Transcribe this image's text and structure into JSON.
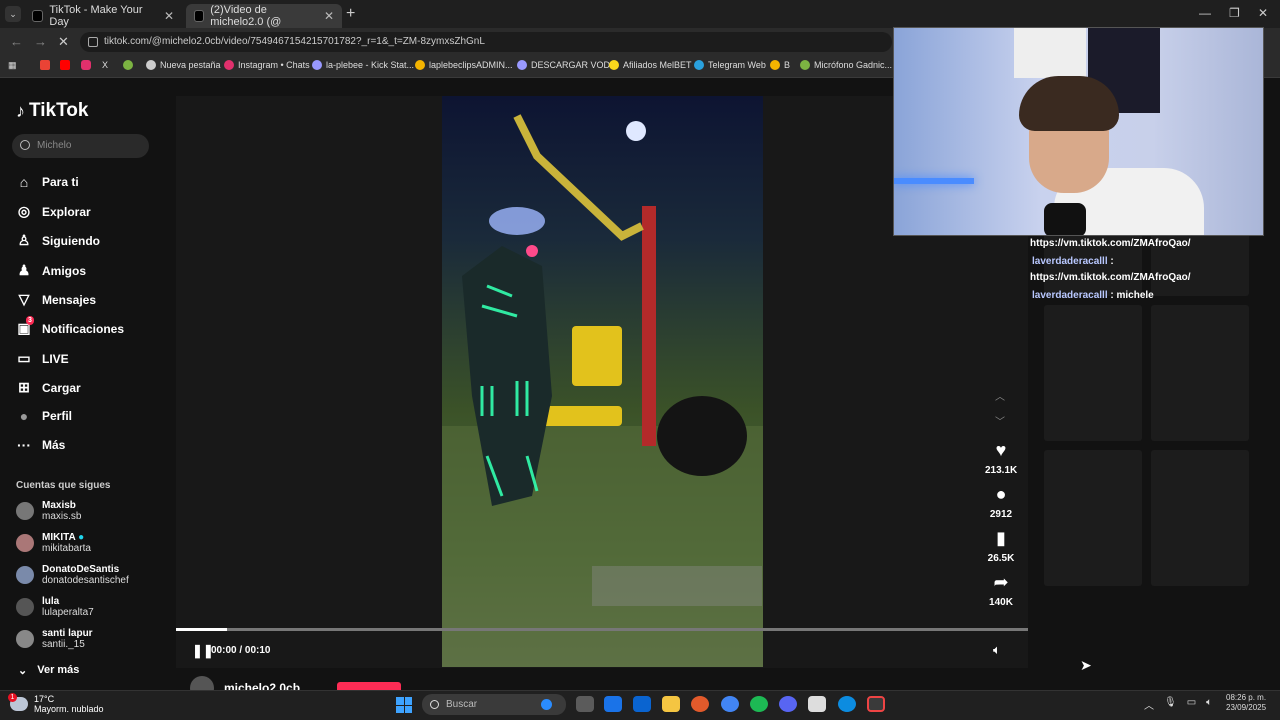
{
  "browser": {
    "tabs": [
      {
        "title": "TikTok - Make Your Day",
        "active": false
      },
      {
        "title": "(2)Video de michelo2.0 (@",
        "active": true
      }
    ],
    "url": "tiktok.com/@michelo2.0cb/video/7549467154215701782?_r=1&_t=ZM-8zymxsZhGnL",
    "bookmarks": [
      {
        "label": "Nueva pestaña",
        "color": "#cccccc"
      },
      {
        "label": "Instagram • Chats",
        "color": "#e1306c"
      },
      {
        "label": "la-plebee - Kick Stat...",
        "color": "#9999ff"
      },
      {
        "label": "laplebeclipsADMIN...",
        "color": "#f4b400"
      },
      {
        "label": "DESCARGAR VODS",
        "color": "#9999ff"
      },
      {
        "label": "Afiliados MelBET",
        "color": "#f9d71c"
      },
      {
        "label": "Telegram Web",
        "color": "#2aa1de"
      },
      {
        "label": "B",
        "color": "#f4b400"
      },
      {
        "label": "Micrófono Gadnic...",
        "color": "#7cb342"
      }
    ]
  },
  "tiktok": {
    "logo": "TikTok",
    "search_placeholder": "Michelo",
    "nav": [
      {
        "label": "Para ti",
        "icon": "home-icon",
        "glyph": "⌂"
      },
      {
        "label": "Explorar",
        "icon": "compass-icon",
        "glyph": "◎"
      },
      {
        "label": "Siguiendo",
        "icon": "following-icon",
        "glyph": "♙"
      },
      {
        "label": "Amigos",
        "icon": "friends-icon",
        "glyph": "♟"
      },
      {
        "label": "Mensajes",
        "icon": "inbox-icon",
        "glyph": "▽"
      },
      {
        "label": "Notificaciones",
        "icon": "notifications-icon",
        "glyph": "▣",
        "badge": "3"
      },
      {
        "label": "LIVE",
        "icon": "live-icon",
        "glyph": "▭"
      },
      {
        "label": "Cargar",
        "icon": "upload-icon",
        "glyph": "⊞"
      },
      {
        "label": "Perfil",
        "icon": "profile-icon",
        "glyph": "●"
      },
      {
        "label": "Más",
        "icon": "more-icon",
        "glyph": "···"
      }
    ],
    "following_heading": "Cuentas que sigues",
    "following": [
      {
        "name": "Maxisb",
        "handle": "maxis.sb"
      },
      {
        "name": "MIKITA",
        "handle": "mikitabarta"
      },
      {
        "name": "DonatoDeSantis",
        "handle": "donatodesantischef"
      },
      {
        "name": "lula",
        "handle": "lulaperalta7"
      },
      {
        "name": "santi lapur",
        "handle": "santii._15"
      }
    ],
    "see_more": "Ver más",
    "video": {
      "time": "00:00 / 00:10",
      "progress": 0.06,
      "author": "michelo2.0cb",
      "actions": [
        {
          "icon": "heart-icon",
          "glyph": "♥",
          "count": "213.1K"
        },
        {
          "icon": "comment-icon",
          "glyph": "●",
          "count": "2912"
        },
        {
          "icon": "bookmark-icon",
          "glyph": "▮",
          "count": "26.5K"
        },
        {
          "icon": "share-icon",
          "glyph": "➦",
          "count": "140K"
        }
      ]
    }
  },
  "stream_chat": [
    {
      "user": "",
      "text": "https://vm.tiktok.com/ZMAfroQao/"
    },
    {
      "user": "laverdaderacalll",
      "text": " :"
    },
    {
      "user": "",
      "text": "https://vm.tiktok.com/ZMAfroQao/"
    },
    {
      "user": "laverdaderacalll",
      "text": " : michele"
    }
  ],
  "taskbar": {
    "weather_temp": "17°C",
    "weather_desc": "Mayorm. nublado",
    "weather_badge": "1",
    "search_placeholder": "Buscar",
    "time": "08:26 p. m.",
    "date": "23/09/2025"
  }
}
